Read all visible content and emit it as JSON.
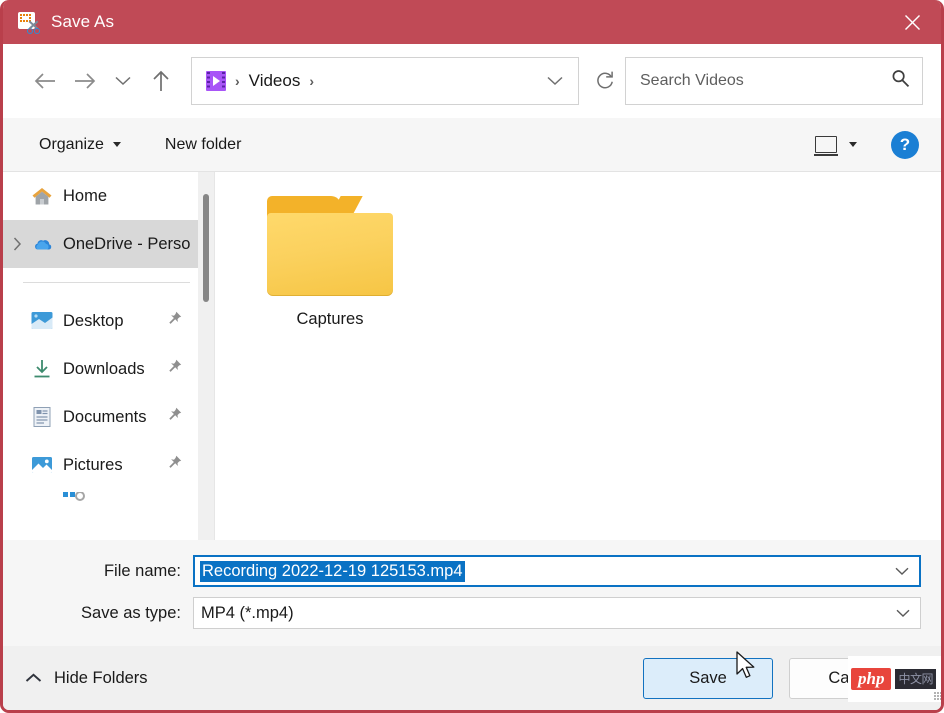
{
  "window": {
    "title": "Save As",
    "title_icon": "snipping-tool-icon",
    "close_label": "✕",
    "accent_color": "#c04a56"
  },
  "nav": {
    "back_label": "Back",
    "forward_label": "Forward",
    "recent_label": "Recent locations",
    "up_label": "Up",
    "refresh_label": "Refresh"
  },
  "address": {
    "location_icon": "videos-folder-icon",
    "crumbs": [
      "Videos"
    ],
    "separator": "›",
    "dropdown_icon": "chevron-down-icon"
  },
  "search": {
    "placeholder": "Search Videos",
    "value": "",
    "icon": "search-icon"
  },
  "command_bar": {
    "organize_label": "Organize",
    "new_folder_label": "New folder",
    "view_icon": "layout-view-icon",
    "view_dropdown_icon": "caret-down-icon",
    "help_label": "?"
  },
  "sidebar": {
    "items": [
      {
        "label": "Home",
        "icon": "home-icon",
        "pinned": false,
        "expandable": false,
        "selected": false
      },
      {
        "label": "OneDrive - Perso",
        "icon": "onedrive-icon",
        "pinned": false,
        "expandable": true,
        "selected": true
      },
      {
        "label": "Desktop",
        "icon": "desktop-icon",
        "pinned": true,
        "expandable": false,
        "selected": false
      },
      {
        "label": "Downloads",
        "icon": "downloads-icon",
        "pinned": true,
        "expandable": false,
        "selected": false
      },
      {
        "label": "Documents",
        "icon": "documents-icon",
        "pinned": true,
        "expandable": false,
        "selected": false
      },
      {
        "label": "Pictures",
        "icon": "pictures-icon",
        "pinned": true,
        "expandable": false,
        "selected": false
      }
    ],
    "scrollbar": "vertical-scrollbar"
  },
  "content": {
    "items": [
      {
        "name": "Captures",
        "type": "folder",
        "icon": "folder-icon"
      }
    ]
  },
  "form": {
    "file_name_label": "File name:",
    "file_name_value": "Recording 2022-12-19 125153.mp4",
    "file_name_selected": true,
    "save_as_type_label": "Save as type:",
    "save_as_type_value": "MP4 (*.mp4)",
    "dropdown_icon": "chevron-down-icon"
  },
  "footer": {
    "hide_folders_label": "Hide Folders",
    "hide_folders_icon": "chevron-up-icon",
    "save_label": "Save",
    "cancel_label": "Cancel"
  },
  "watermark": {
    "badge": "php",
    "text": "中文网"
  }
}
